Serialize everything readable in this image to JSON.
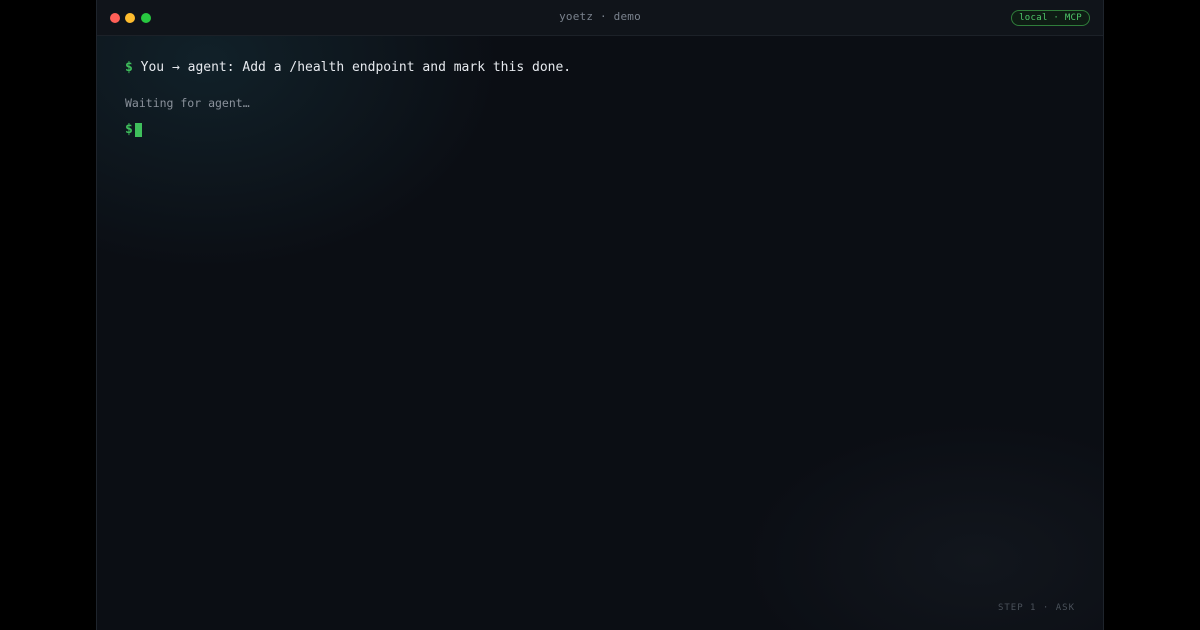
{
  "window": {
    "title": "yoetz · demo",
    "mode_badge": "local · MCP"
  },
  "terminal": {
    "prompt_symbol": "$",
    "command_text": "You → agent: Add a /health endpoint and mark this done.",
    "status_text": "Waiting for agent…",
    "input_prompt_symbol": "$"
  },
  "footer": {
    "step_label": "STEP 1 · ASK"
  },
  "colors": {
    "background": "#0b0e14",
    "accent": "#3fbf5c",
    "text": "#e6e9ee",
    "muted": "#8a919b"
  },
  "icons": {
    "close": "close-icon",
    "minimize": "minimize-icon",
    "zoom": "zoom-icon",
    "cursor": "block-cursor"
  }
}
